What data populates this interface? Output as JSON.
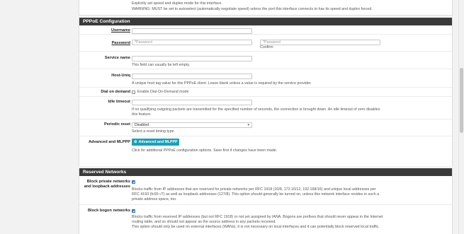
{
  "top_help": {
    "line1": "Explicitly set speed and duplex mode for this interface.",
    "line2": "WARNING: MUST be set to autoselect (automatically negotiate speed) unless the port this interface connects to has its speed and duplex forced."
  },
  "pppoe": {
    "heading": "PPPoE Configuration",
    "username_label": "Username",
    "password_label": "Password",
    "password_placeholder": "*Password",
    "confirm_placeholder": "*Password",
    "confirm_label": "Confirm",
    "service_label": "Service name",
    "service_help": "This field can usually be left empty.",
    "hostuniq_label": "Host-Uniq",
    "hostuniq_help": "A unique host tag value for this PPPoE client. Leave blank unless a value is required by the service provider.",
    "dod_label": "Dial on demand",
    "dod_checkbox_text": "Enable Dial-On-Demand mode",
    "idle_label": "Idle timeout",
    "idle_help_1": "If no qualifying outgoing packets are transmitted for the specified number of seconds, the connection is brought down. An idle timeout of zero disables",
    "idle_help_2": "this feature.",
    "reset_label": "Periodic reset",
    "reset_selected": "Disabled",
    "reset_help": "Select a reset timing type.",
    "adv_label": "Advanced and MLPPP",
    "adv_button": "Advanced and MLPPP",
    "adv_help": "Click for additional PPPoE configuration options. Save first if changes have been made."
  },
  "reserved": {
    "heading": "Reserved Networks",
    "private_label_1": "Block private networks",
    "private_label_2": "and loopback addresses",
    "private_help_1": "Blocks traffic from IP addresses that are reserved for private networks per RFC 1918 (10/8, 172.16/12, 192.168/16) and unique local addresses per",
    "private_help_2": "RFC 4193 (fc00::/7) as well as loopback addresses (127/8). This option should generally be turned on, unless this network interface resides in such a",
    "private_help_3": "private address space, too.",
    "bogon_label": "Block bogon networks",
    "bogon_help_1": "Blocks traffic from reserved IP addresses (but not RFC 1918) or not yet assigned by IANA. Bogons are prefixes that should never appear in the Internet",
    "bogon_help_2": "routing table, and so should not appear as the source address in any packets received.",
    "bogon_help_3": "This option should only be used on external interfaces (WANs), it is not necessary on local interfaces and it can potentially block reserved local traffic."
  }
}
